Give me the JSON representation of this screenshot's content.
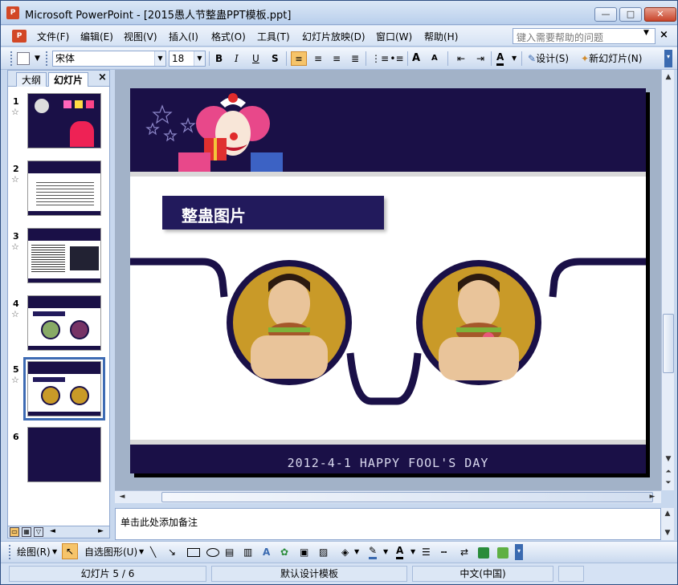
{
  "window": {
    "app_name": "Microsoft PowerPoint",
    "title": "Microsoft PowerPoint - [2015愚人节整蛊PPT模板.ppt]",
    "buttons": {
      "minimize": "—",
      "maximize": "□",
      "close": "✕"
    }
  },
  "menu": {
    "items": [
      "文件(F)",
      "编辑(E)",
      "视图(V)",
      "插入(I)",
      "格式(O)",
      "工具(T)",
      "幻灯片放映(D)",
      "窗口(W)",
      "帮助(H)"
    ],
    "help_placeholder": "键入需要帮助的问题",
    "close_doc": "×"
  },
  "toolbar": {
    "font_name": "宋体",
    "font_size": "18",
    "bold": "B",
    "italic": "I",
    "underline": "U",
    "shadow": "S",
    "grow_font": "A",
    "shrink_font": "A",
    "font_color": "A",
    "design_label": "设计(S)",
    "new_slide_label": "新幻灯片(N)"
  },
  "outline_pane": {
    "tab_outline": "大纲",
    "tab_slides": "幻灯片",
    "close": "×",
    "slides": [
      {
        "number": "1",
        "has_transition": true
      },
      {
        "number": "2",
        "has_transition": true
      },
      {
        "number": "3",
        "has_transition": true
      },
      {
        "number": "4",
        "has_transition": true
      },
      {
        "number": "5",
        "has_transition": true,
        "selected": true
      },
      {
        "number": "6",
        "has_transition": false
      }
    ],
    "star_glyph": "☆"
  },
  "slide": {
    "title": "整蛊图片",
    "footer": "2012-4-1 HAPPY FOOL'S DAY",
    "colors": {
      "navy": "#1a1047",
      "title_box": "#221a5c",
      "photo_bg": "#c99a28",
      "grey_bar": "#d9d9d9"
    }
  },
  "notes": {
    "placeholder": "单击此处添加备注"
  },
  "draw_toolbar": {
    "draw_label": "绘图(R)",
    "autoshapes_label": "自选图形(U)"
  },
  "status": {
    "slide_info": "幻灯片 5 / 6",
    "design": "默认设计模板",
    "language": "中文(中国)"
  }
}
